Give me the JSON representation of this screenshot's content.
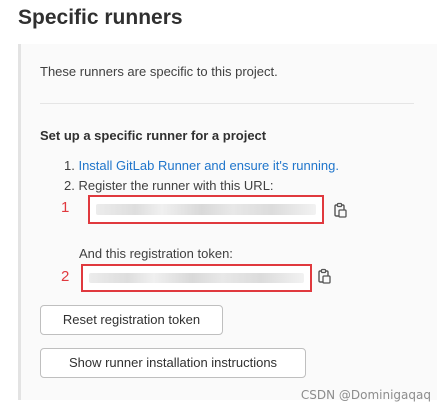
{
  "section": {
    "title": "Specific runners",
    "description": "These runners are specific to this project.",
    "setup_heading": "Set up a specific runner for a project",
    "steps": {
      "step1_number": "1.",
      "step1_link": "Install GitLab Runner and ensure it's running.",
      "step2_text": "2. Register the runner with this URL:"
    },
    "token_label": "And this registration token:"
  },
  "annotations": {
    "marker_url": "1",
    "marker_token": "2",
    "color": "#e0393e"
  },
  "buttons": {
    "reset_token": "Reset registration token",
    "show_instructions": "Show runner installation instructions"
  },
  "icons": {
    "copy_url": "copy-icon",
    "copy_token": "copy-icon"
  },
  "watermark": "CSDN @Dominigaqaq"
}
